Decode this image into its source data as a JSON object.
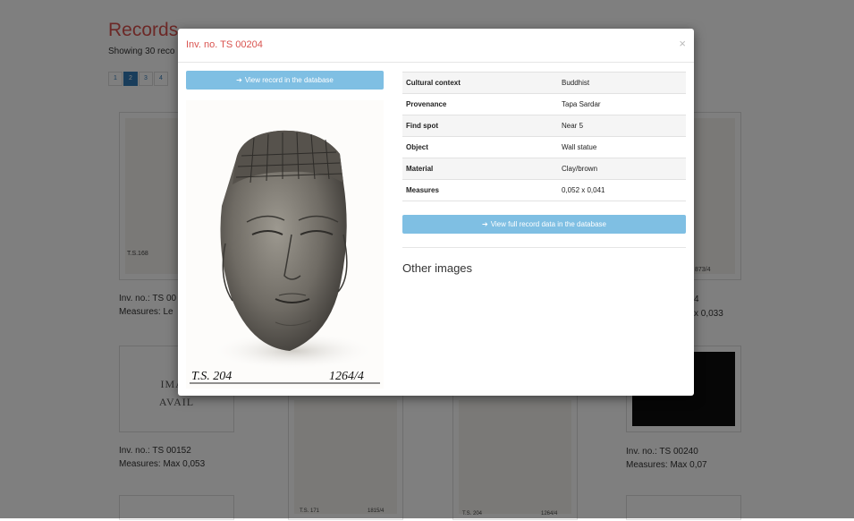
{
  "page": {
    "title": "Records",
    "subtitle": "Showing 30 reco",
    "pagination": [
      "1",
      "2",
      "3",
      "4"
    ],
    "active_page": "2"
  },
  "cards": [
    {
      "inv": "Inv. no.: TS 00",
      "measures": "Measures: Le",
      "tag_left": "T.S.168"
    },
    {
      "inv": "4",
      "measures": "x 0,033",
      "tag_right": "873/4"
    },
    {
      "inv": "Inv. no.: TS 00152",
      "measures": "Measures: Max 0,053",
      "noimage_line1": "IMAG",
      "noimage_line2": "AVAIL"
    },
    {
      "tag_left": "T.S. 171",
      "tag_right": "1815/4"
    },
    {
      "tag_left": "T.S. 204",
      "tag_right": "1264/4"
    },
    {
      "inv": "Inv. no.: TS 00240",
      "measures": "Measures: Max 0,07"
    }
  ],
  "modal": {
    "title": "Inv. no. TS 00204",
    "close": "×",
    "view_record_label": "View record in the database",
    "view_full_label": "View full record data in the database",
    "properties": [
      {
        "key": "Cultural context",
        "value": "Buddhist"
      },
      {
        "key": "Provenance",
        "value": "Tapa Sardar"
      },
      {
        "key": "Find spot",
        "value": "Near 5"
      },
      {
        "key": "Object",
        "value": "Wall statue"
      },
      {
        "key": "Material",
        "value": "Clay/brown"
      },
      {
        "key": "Measures",
        "value": "0,052 x 0,041"
      }
    ],
    "other_images_heading": "Other images",
    "photo_label_left": "T.S. 204",
    "photo_label_right": "1264/4"
  },
  "colors": {
    "title_red": "#d9534f",
    "button_blue": "#7fbfe3",
    "pager_blue": "#337ab7"
  }
}
